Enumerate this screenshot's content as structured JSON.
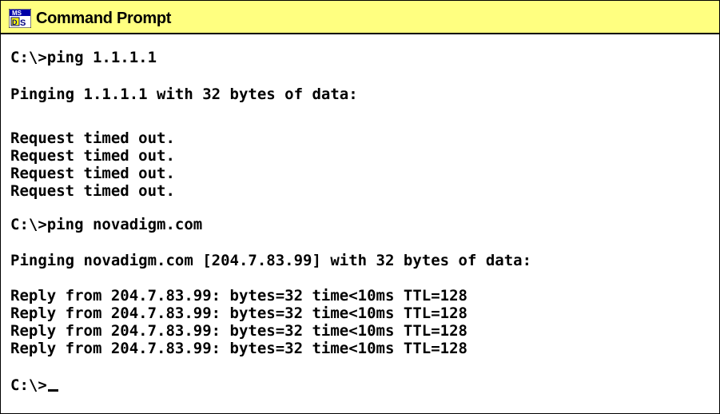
{
  "window": {
    "title": "Command Prompt",
    "icon": "ms-dos-icon"
  },
  "console": {
    "lines": [
      "C:\\>ping 1.1.1.1",
      "Pinging 1.1.1.1 with 32 bytes of data:",
      "Request timed out.",
      "Request timed out.",
      "Request timed out.",
      "Request timed out.",
      "C:\\>ping novadigm.com",
      "Pinging novadigm.com [204.7.83.99] with 32 bytes of data:",
      "Reply from 204.7.83.99: bytes=32 time<10ms TTL=128",
      "Reply from 204.7.83.99: bytes=32 time<10ms TTL=128",
      "Reply from 204.7.83.99: bytes=32 time<10ms TTL=128",
      "Reply from 204.7.83.99: bytes=32 time<10ms TTL=128",
      "C:\\>"
    ]
  },
  "colors": {
    "titlebar_bg": "#ffff80",
    "text": "#000000",
    "console_bg": "#ffffff"
  }
}
